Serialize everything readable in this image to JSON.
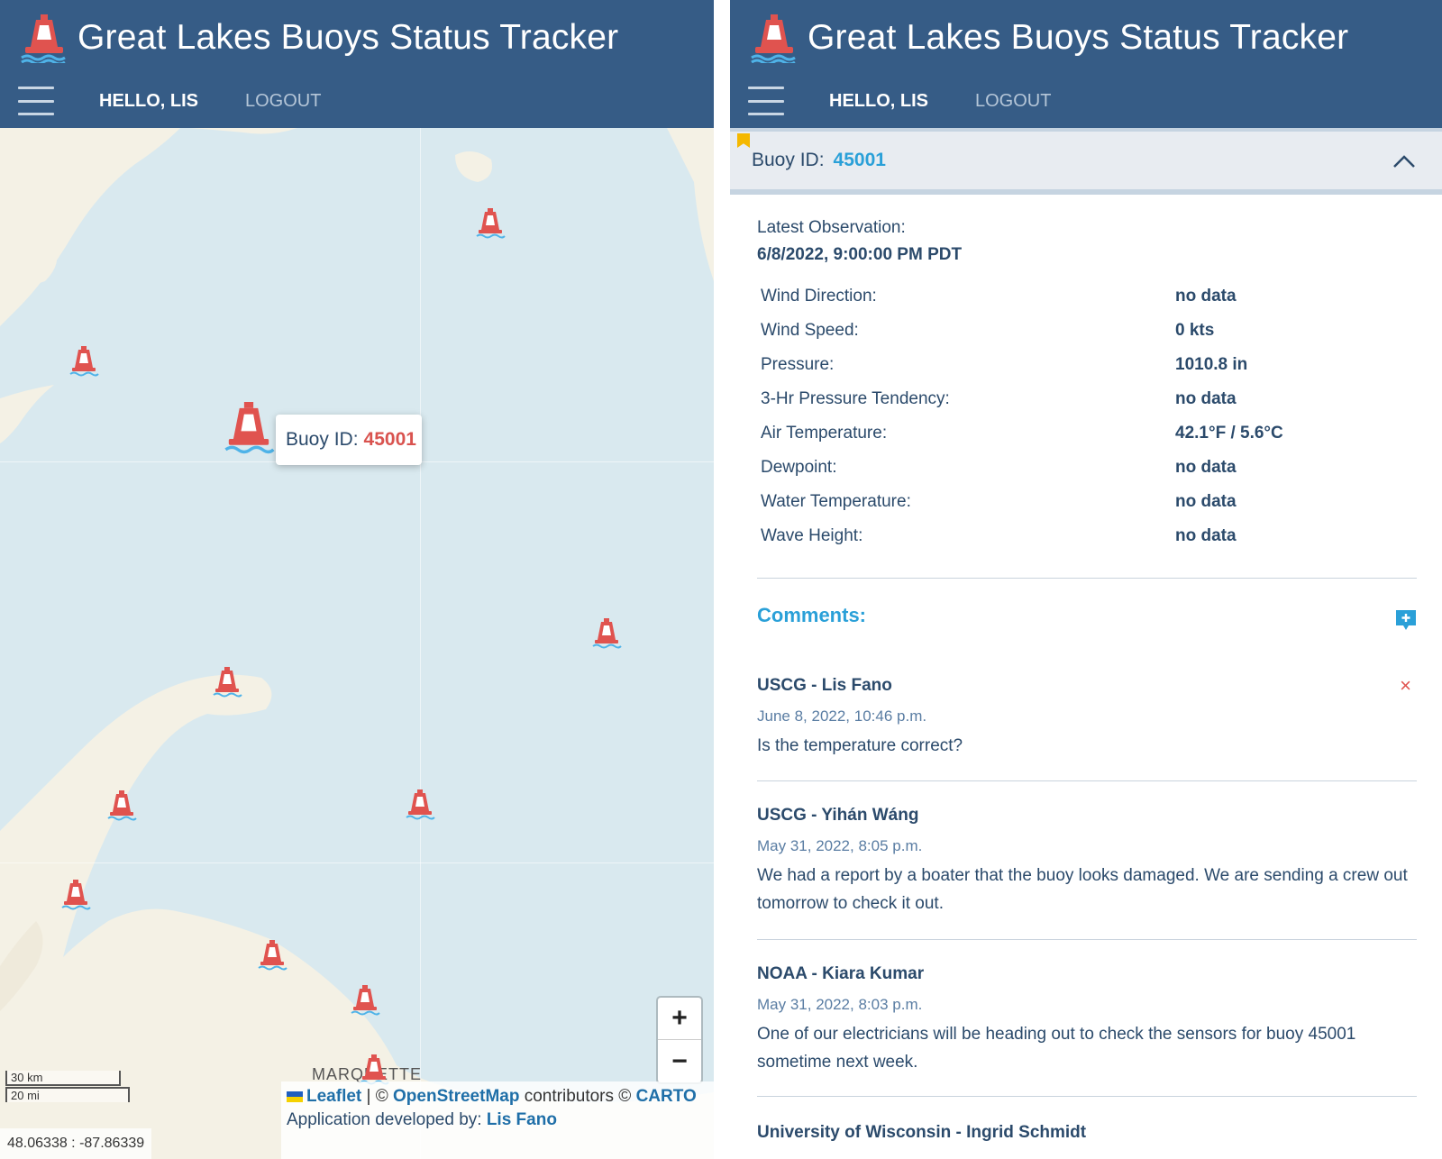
{
  "app": {
    "title": "Great Lakes Buoys Status Tracker",
    "hello": "HELLO, LIS",
    "logout": "LOGOUT"
  },
  "map": {
    "popup_label": "Buoy ID:",
    "popup_id": "45001",
    "zoom_in": "+",
    "zoom_out": "−",
    "scale_km": "30 km",
    "scale_mi": "20 mi",
    "coordinates": "48.06338 : -87.86339",
    "city_label": "MARQUETTE",
    "attribution": {
      "leaflet": "Leaflet",
      "sep": "| ©",
      "osm": "OpenStreetMap",
      "contributors": "contributors ©",
      "carto": "CARTO",
      "developed_by": "Application developed by:",
      "developer": "Lis Fano"
    },
    "colors": {
      "water": "#d9e9ef",
      "land": "#f4f1e5",
      "buoy": "#e0534f"
    }
  },
  "details": {
    "buoy_label": "Buoy ID:",
    "buoy_id": "45001",
    "latest_observation_label": "Latest Observation:",
    "latest_observation_time": "6/8/2022, 9:00:00 PM PDT",
    "observations": [
      {
        "label": "Wind Direction:",
        "value": "no data"
      },
      {
        "label": "Wind Speed:",
        "value": "0 kts"
      },
      {
        "label": "Pressure:",
        "value": "1010.8 in"
      },
      {
        "label": "3-Hr Pressure Tendency:",
        "value": "no data"
      },
      {
        "label": "Air Temperature:",
        "value": "42.1°F / 5.6°C"
      },
      {
        "label": "Dewpoint:",
        "value": "no data"
      },
      {
        "label": "Water Temperature:",
        "value": "no data"
      },
      {
        "label": "Wave Height:",
        "value": "no data"
      }
    ],
    "comments_title": "Comments:",
    "delete_glyph": "×",
    "comments": [
      {
        "author": "USCG - Lis Fano",
        "date": "June 8, 2022, 10:46 p.m.",
        "text": "Is the temperature correct?"
      },
      {
        "author": "USCG - Yihán Wáng",
        "date": "May 31, 2022, 8:05 p.m.",
        "text": "We had a report by a boater that the buoy looks damaged. We are sending a crew out tomorrow to check it out."
      },
      {
        "author": "NOAA - Kiara Kumar",
        "date": "May 31, 2022, 8:03 p.m.",
        "text": "One of our electricians will be heading out to check the sensors for buoy 45001 sometime next week."
      },
      {
        "author": "University of Wisconsin - Ingrid Schmidt",
        "date": "",
        "text": ""
      }
    ]
  }
}
